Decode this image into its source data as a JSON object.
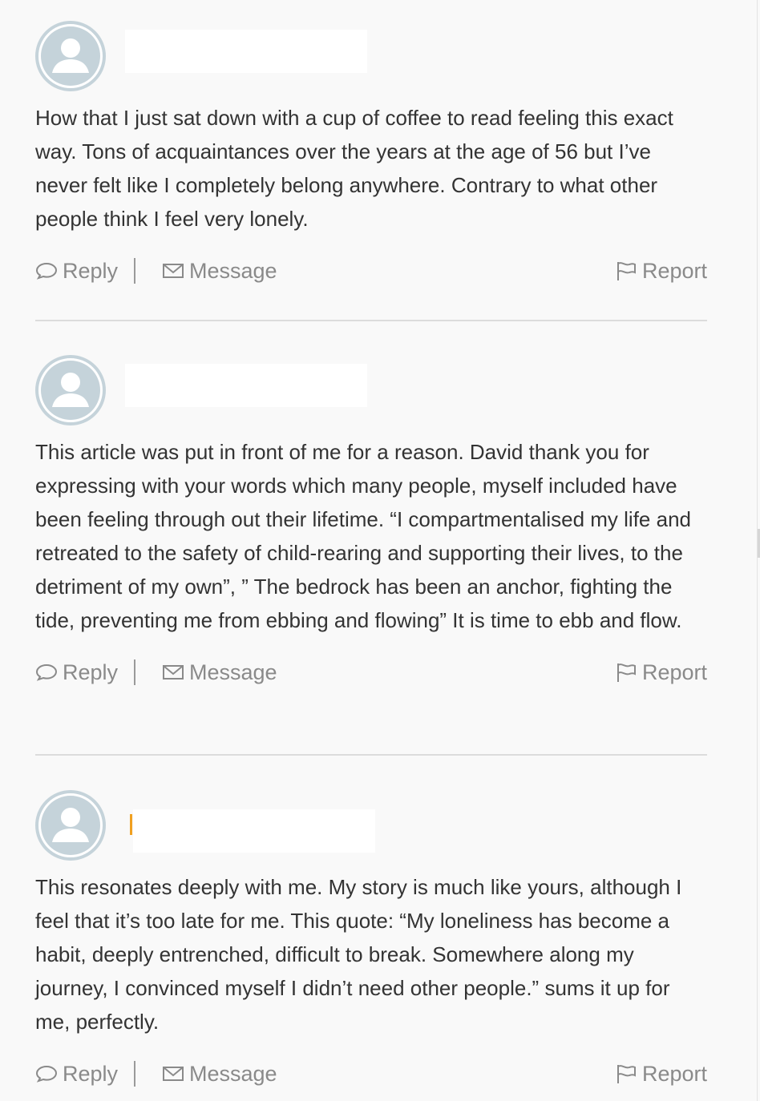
{
  "comments": [
    {
      "author": "",
      "text": "How that I just sat down with a cup of coffee to read feeling this exact way. Tons of acquaintances over the years at the age of 56 but I’ve never felt like I completely belong anywhere. Contrary to what other people think I feel very lonely.",
      "actions": {
        "reply": "Reply",
        "message": "Message",
        "report": "Report"
      }
    },
    {
      "author": "",
      "text": "This article was put in front of me for a reason. David thank you for expressing with your words which many people, myself included have been feeling through out their lifetime. “I compartmentalised my life and retreated to the safety of child-rearing and supporting their lives, to the detriment of my own”, ” The bedrock has been an anchor, fighting the tide, preventing me from ebbing and flowing” It is time to ebb and flow.",
      "actions": {
        "reply": "Reply",
        "message": "Message",
        "report": "Report"
      }
    },
    {
      "author": "",
      "text": "This resonates deeply with me. My story is much like yours, although I feel that it’s too late for me. This quote: “My loneliness has become a habit, deeply entrenched, difficult to break. Somewhere along my journey, I convinced myself I didn’t need other people.” sums it up for me, perfectly.",
      "actions": {
        "reply": "Reply",
        "message": "Message",
        "report": "Report"
      }
    }
  ],
  "icons": {
    "avatar": "default-avatar-icon",
    "reply": "speech-bubble-icon",
    "message": "envelope-icon",
    "report": "flag-icon"
  },
  "colors": {
    "background": "#f9f9f9",
    "text": "#333333",
    "action_text": "#8a8a8a",
    "avatar_fill": "#c5d3da",
    "accent": "#f0a020"
  }
}
